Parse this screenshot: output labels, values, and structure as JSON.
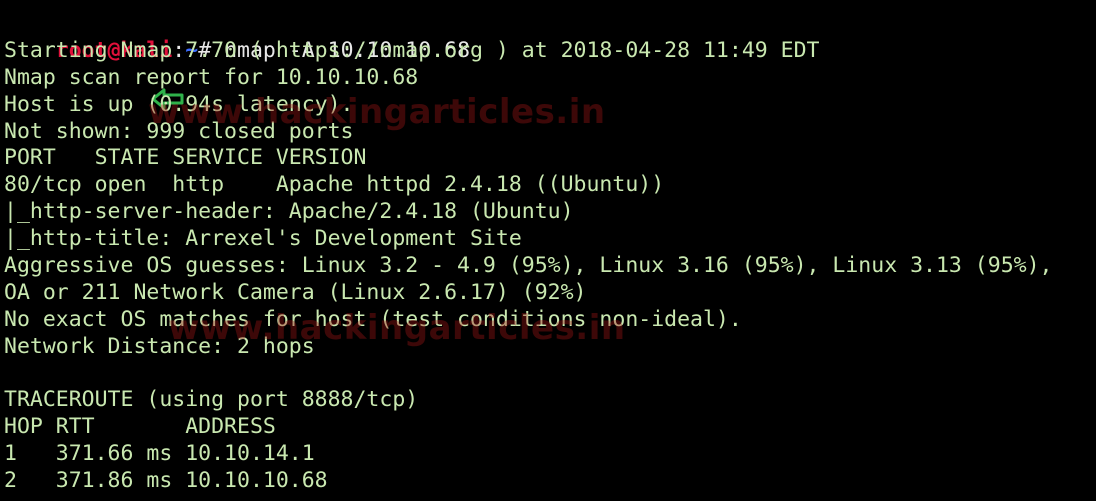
{
  "prompt": {
    "user": "root@kali",
    "path": "~",
    "symbol": "# ",
    "command": "nmap -A 10.10.10.68",
    "arrow_icon": "green-left-arrow-icon",
    "arrow_color": "#2fb24a"
  },
  "output": [
    "Starting Nmap 7.70 ( https://nmap.org ) at 2018-04-28 11:49 EDT",
    "Nmap scan report for 10.10.10.68",
    "Host is up (0.94s latency).",
    "Not shown: 999 closed ports",
    "PORT   STATE SERVICE VERSION",
    "80/tcp open  http    Apache httpd 2.4.18 ((Ubuntu))",
    "|_http-server-header: Apache/2.4.18 (Ubuntu)",
    "|_http-title: Arrexel's Development Site",
    "Aggressive OS guesses: Linux 3.2 - 4.9 (95%), Linux 3.16 (95%), Linux 3.13 (95%),",
    "OA or 211 Network Camera (Linux 2.6.17) (92%)",
    "No exact OS matches for host (test conditions non-ideal).",
    "Network Distance: 2 hops",
    "",
    "TRACEROUTE (using port 8888/tcp)",
    "HOP RTT       ADDRESS",
    "1   371.66 ms 10.10.14.1",
    "2   371.86 ms 10.10.10.68"
  ],
  "watermarks": [
    "www.hackingarticles.in",
    "www.hackingarticles.in"
  ],
  "colors": {
    "background": "#000000",
    "output_text": "#c9e8b0",
    "prompt_user": "#e1103a",
    "prompt_path": "#3b6cff",
    "watermark": "#a01414"
  }
}
